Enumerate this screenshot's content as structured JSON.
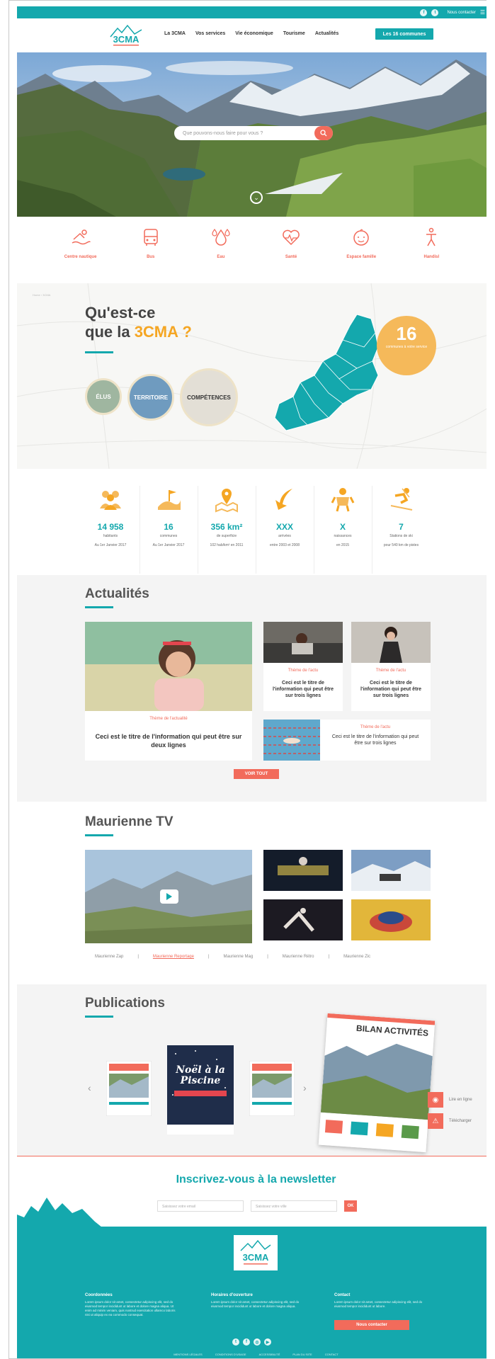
{
  "topbar": {
    "contact": "Nous contacter",
    "icons": [
      "facebook-icon",
      "twitter-icon",
      "menu-icon"
    ]
  },
  "header": {
    "logo_text": "3CMA",
    "nav": [
      "La 3CMA",
      "Vos services",
      "Vie économique",
      "Tourisme",
      "Actualités"
    ],
    "cta": "Les 16 communes"
  },
  "hero": {
    "search_placeholder": "Que pouvons-nous faire pour vous ?"
  },
  "services": [
    "Centre nautique",
    "Bus",
    "Eau",
    "Santé",
    "Espace famille",
    "Handisl"
  ],
  "about": {
    "breadcrumb": "Home › 3CMA",
    "title_l1": "Qu'est-ce",
    "title_l2a": "que la ",
    "title_l2b": "3CMA ?",
    "bubbles": [
      "ÉLUS",
      "TERRITOIRE",
      "COMPÉTENCES"
    ],
    "badge_number": "16",
    "badge_text": "communes à votre service"
  },
  "stats": [
    {
      "value": "14 958",
      "label": "habitants",
      "sub": "Au 1er Janvier 2017"
    },
    {
      "value": "16",
      "label": "communes",
      "sub": "Au 1er Janvier 2017"
    },
    {
      "value": "356 km²",
      "label": "de superficie",
      "sub": "102 hab/km² en 2011"
    },
    {
      "value": "XXX",
      "label": "arrivées",
      "sub": "entre 2003 et 2008"
    },
    {
      "value": "X",
      "label": "naissances",
      "sub": "en 2015"
    },
    {
      "value": "7",
      "label": "Stations de ski",
      "sub": "pour 540 km de pistes"
    }
  ],
  "actus": {
    "title": "Actualités",
    "main": {
      "theme": "Thème de l'actualité",
      "title": "Ceci est le titre de l'information qui peut être sur deux lignes"
    },
    "small": [
      {
        "theme": "Thème de l'actu",
        "title": "Ceci est le titre de l'information qui peut être sur trois lignes"
      },
      {
        "theme": "Thème de l'actu",
        "title": "Ceci est le titre de l'information qui peut être sur trois lignes"
      },
      {
        "theme": "Thème de l'actu",
        "title": "Ceci est le titre de l'information qui peut être sur trois lignes"
      }
    ],
    "button": "VOIR TOUT"
  },
  "tv": {
    "title": "Maurienne TV",
    "tabs": [
      "Maurienne Zap",
      "Maurienne Reportage",
      "Maurienne Mag",
      "Maurienne Rétro",
      "Maurienne Zic"
    ],
    "active": 1
  },
  "pubs": {
    "title": "Publications",
    "cover_title": "Noël à la Piscine",
    "featured": "BILAN ACTIVITÉS",
    "read": "Lire en ligne",
    "download": "Télécharger"
  },
  "newsletter": {
    "title": "Inscrivez-vous à la newsletter",
    "email_placeholder": "Saisissez votre email",
    "city_placeholder": "Saisissez votre ville",
    "submit": "OK"
  },
  "footer": {
    "cols": [
      {
        "h": "Coordonnées",
        "p": "Lorem ipsum dolor sit amet, consectetur adipiscing elit, sed do eiusmod tempor incididunt ut labore et dolore magna aliqua. Ut enim ad minim veniam, quis nostrud exercitation ullamco laboris nisi ut aliquip ex ea commodo consequat."
      },
      {
        "h": "Horaires d'ouverture",
        "p": "Lorem ipsum dolor sit amet, consectetur adipiscing elit, sed do eiusmod tempor incididunt ut labore et dolore magna aliqua."
      },
      {
        "h": "Contact",
        "p": "Lorem ipsum dolor sit amet, consectetur adipiscing elit, sed do eiusmod tempor incididunt ut labore."
      }
    ],
    "contact_button": "Nous contacter",
    "links": [
      "MENTIONS LÉGALES",
      "CONDITIONS D'USAGE",
      "ACCESSIBILITÉ",
      "PLAN DU SITE",
      "CONTACT"
    ]
  },
  "colors": {
    "teal": "#14a8ad",
    "coral": "#f26b5b",
    "orange": "#f5a623"
  }
}
